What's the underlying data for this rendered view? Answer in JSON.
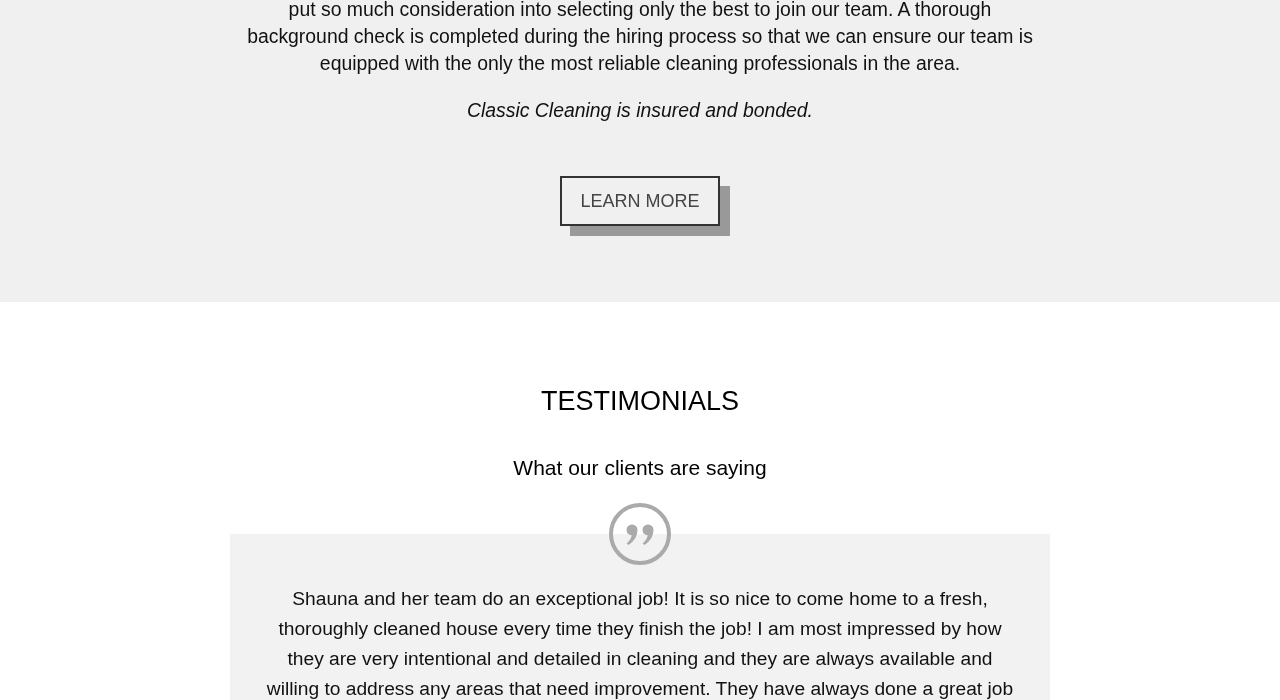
{
  "about": {
    "paragraph": "put so much consideration into selecting only the best to join our team. A thorough background check is completed during the hiring process so that we can ensure our team is equipped with the only the most reliable cleaning professionals in the area.",
    "note": "Classic Cleaning is insured and bonded.",
    "button": "LEARN MORE"
  },
  "testimonials": {
    "heading": "TESTIMONIALS",
    "subheading": "What our clients are saying",
    "items": [
      {
        "text": "Shauna and her team do an exceptional job! It is so nice to come home to a fresh, thoroughly cleaned house every time they finish the job! I am most impressed by how they are very intentional and detailed in cleaning and they are always available and willing to address any areas that need improvement. They have always done a great job"
      }
    ]
  }
}
